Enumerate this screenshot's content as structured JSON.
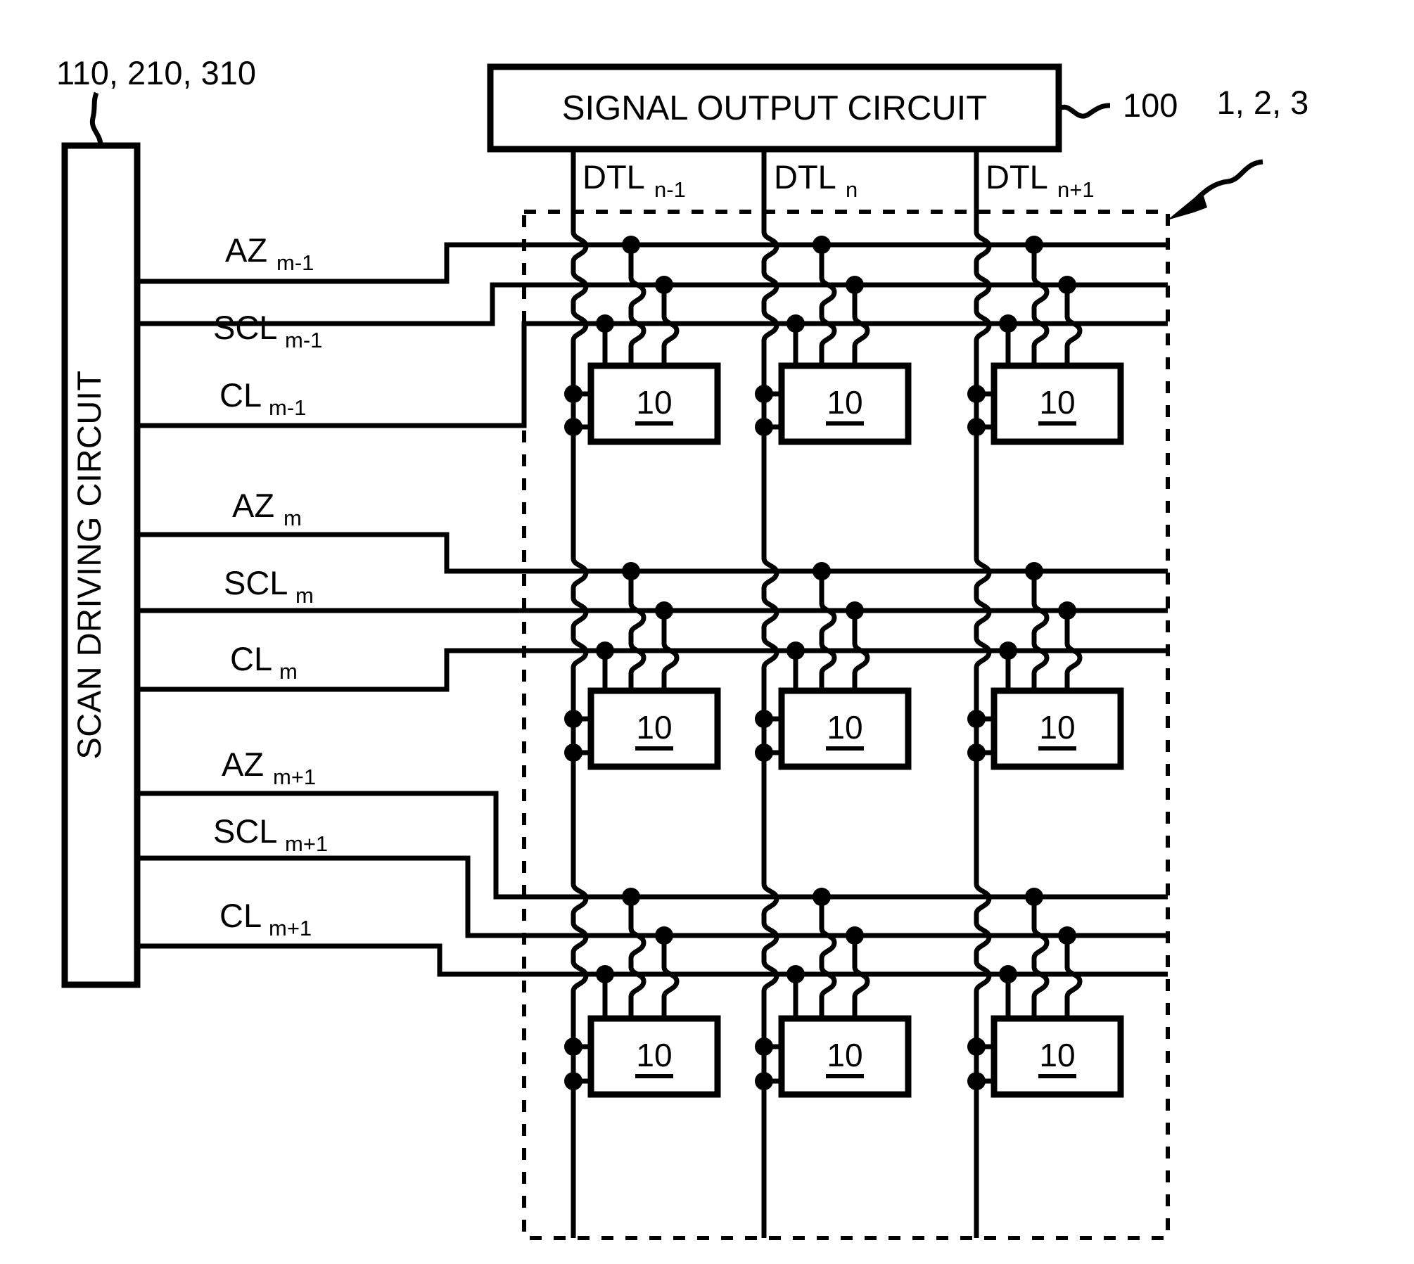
{
  "figure": {
    "type": "patent-circuit-diagram",
    "reference_numerals": {
      "scan_driving_circuit": "110, 210, 310",
      "signal_output_circuit": "100",
      "display_panel_area": "1, 2, 3",
      "pixel_circuit": "10"
    }
  },
  "blocks": {
    "signal_output_circuit": {
      "label": "SIGNAL OUTPUT CIRCUIT",
      "ref": "100",
      "ref_marker": "~"
    },
    "scan_driving_circuit": {
      "label": "SCAN DRIVING CIRCUIT",
      "ref": "110, 210, 310"
    },
    "panel_ref": "1, 2, 3"
  },
  "data_lines": [
    {
      "base": "DTL",
      "sub": "n-1"
    },
    {
      "base": "DTL",
      "sub": "n"
    },
    {
      "base": "DTL",
      "sub": "n+1"
    }
  ],
  "scan_line_rows": [
    {
      "lines": [
        {
          "base": "AZ",
          "sub": "m-1"
        },
        {
          "base": "SCL",
          "sub": "m-1"
        },
        {
          "base": "CL",
          "sub": "m-1"
        }
      ]
    },
    {
      "lines": [
        {
          "base": "AZ",
          "sub": "m"
        },
        {
          "base": "SCL",
          "sub": "m"
        },
        {
          "base": "CL",
          "sub": "m"
        }
      ]
    },
    {
      "lines": [
        {
          "base": "AZ",
          "sub": "m+1"
        },
        {
          "base": "SCL",
          "sub": "m+1"
        },
        {
          "base": "CL",
          "sub": "m+1"
        }
      ]
    }
  ],
  "pixel_cells": {
    "label": "10",
    "rows": 3,
    "cols": 3
  },
  "colors": {
    "line": "#000000",
    "background": "#ffffff"
  }
}
